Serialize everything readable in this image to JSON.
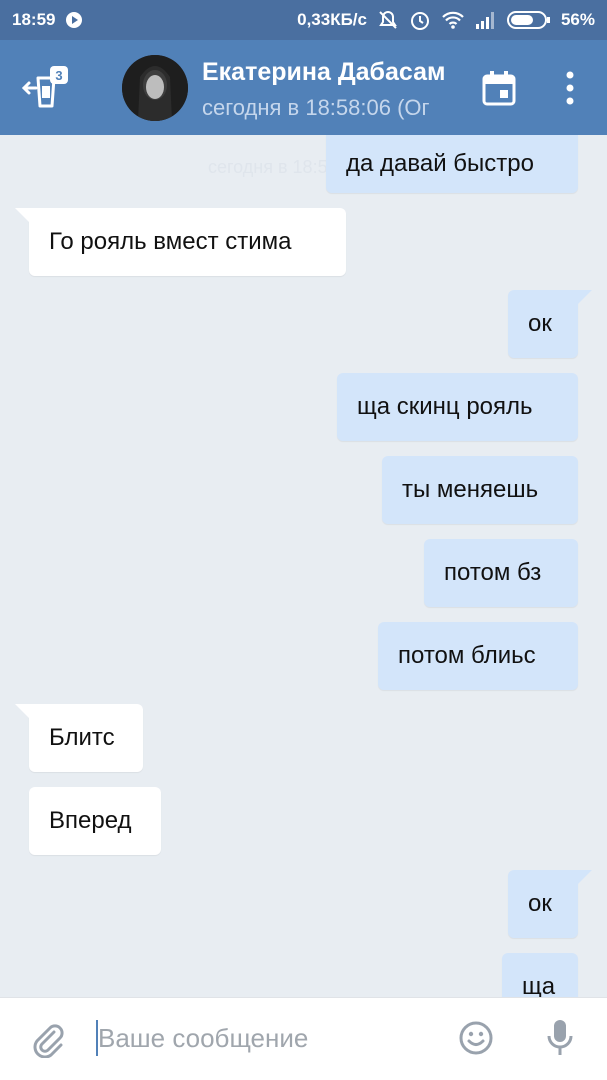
{
  "statusbar": {
    "time": "18:59",
    "speed": "0,33КБ/с",
    "battery": "56%",
    "icons": [
      "play-icon",
      "mute-icon",
      "alarm-icon",
      "wifi-icon",
      "signal-icon",
      "battery-icon"
    ]
  },
  "header": {
    "back_badge": "3",
    "name": "Екатерина Дабасам",
    "status": "сегодня в 18:58:06 (Ог",
    "icons": [
      "back-arrow-icon",
      "calendar-icon",
      "more-vertical-icon"
    ]
  },
  "chat": {
    "ghost_date": "сегодня в 18:55",
    "messages": [
      {
        "dir": "out",
        "text": "да давай быстро"
      },
      {
        "dir": "in",
        "text": "Го рояль вмест стима"
      },
      {
        "dir": "out",
        "text": "ок"
      },
      {
        "dir": "out",
        "text": "ща скинц рояль"
      },
      {
        "dir": "out",
        "text": "ты меняешь"
      },
      {
        "dir": "out",
        "text": "потом бз"
      },
      {
        "dir": "out",
        "text": "потом блиьс"
      },
      {
        "dir": "in",
        "text": "Блитс"
      },
      {
        "dir": "in",
        "text": "Вперед"
      },
      {
        "dir": "out",
        "text": "ок"
      },
      {
        "dir": "out",
        "text": "ща"
      }
    ]
  },
  "compose": {
    "placeholder": "Ваше сообщение",
    "value": "",
    "icons": [
      "paperclip-icon",
      "emoji-icon",
      "microphone-icon"
    ]
  },
  "colors": {
    "statusbar": "#4a6fa0",
    "header": "#5181b8",
    "background": "#e8edf2",
    "outgoing_bubble": "#d3e5fa",
    "incoming_bubble": "#ffffff"
  }
}
